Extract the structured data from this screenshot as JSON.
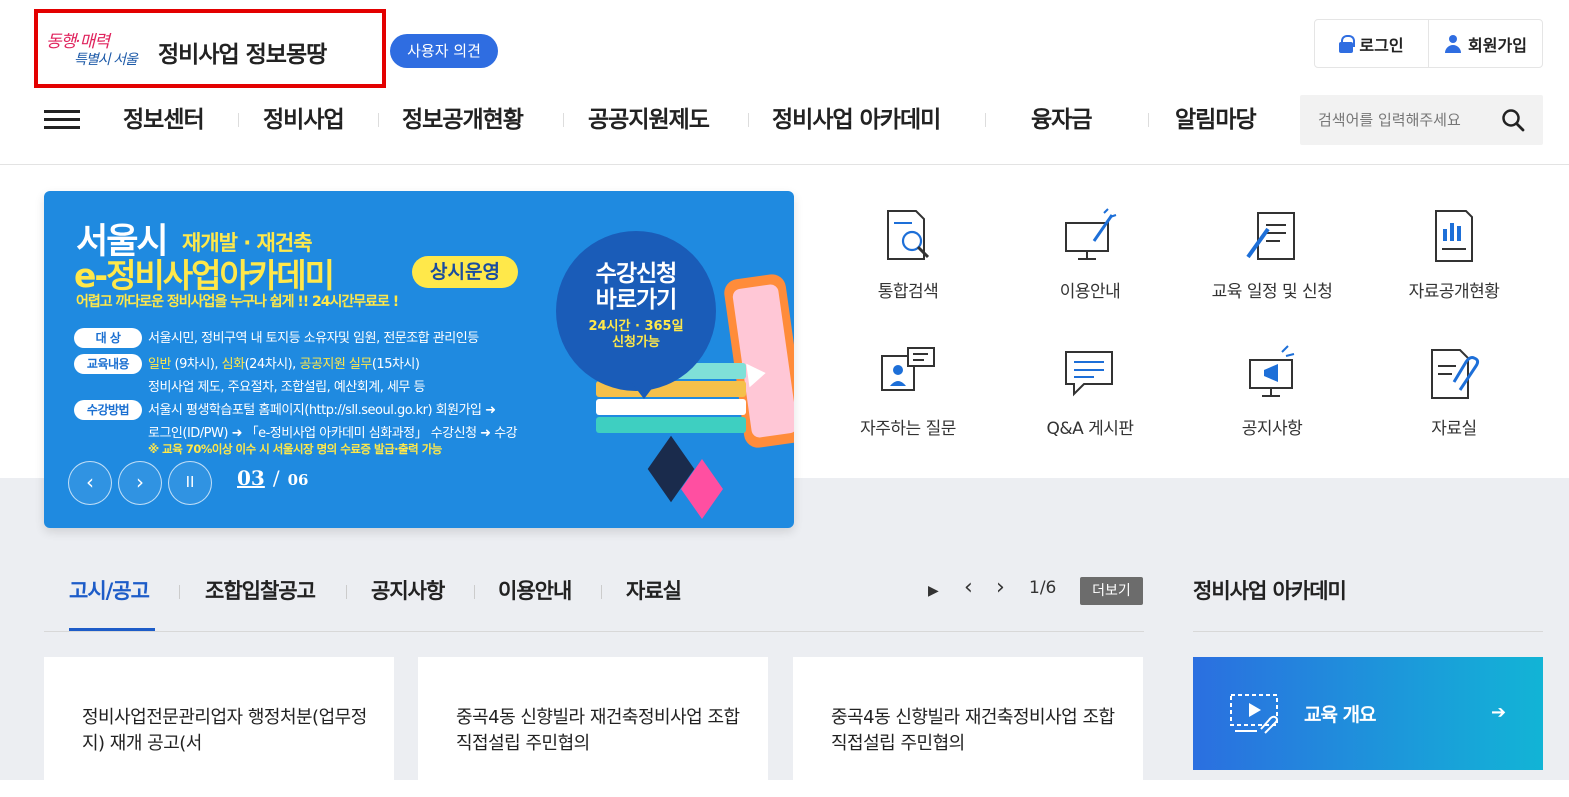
{
  "header": {
    "logo_line1": "동행·매력",
    "logo_line2": "특별시 서울",
    "site_title": "정비사업 정보몽땅",
    "opinion_button": "사용자 의견",
    "login": "로그인",
    "signup": "회원가입"
  },
  "nav": {
    "items": [
      "정보센터",
      "정비사업",
      "정보공개현황",
      "공공지원제도",
      "정비사업 아카데미",
      "융자금",
      "알림마당"
    ]
  },
  "search": {
    "placeholder": "검색어를 입력해주세요"
  },
  "banner": {
    "title1": "서울시",
    "title1_sub": "재개발 · 재건축",
    "title2": "e-정비사업아카데미",
    "badge": "상시운영",
    "subtitle": "어렵고 까다로운 정비사업을  누구나 쉽게 !!  24시간무료로 !",
    "rows": [
      {
        "chip": "대    상",
        "text": "서울시민, 정비구역 내 토지등 소유자및 임원, 전문조합 관리인등",
        "cont": ""
      },
      {
        "chip": "교육내용",
        "hl1": "일반",
        "text1": " (9차시), ",
        "hl2": "심화",
        "text2": "(24차시), ",
        "hl3": "공공지원 실무",
        "text3": "(15차시)",
        "cont": "정비사업 제도, 주요절차, 조합설립, 예산회계, 세무 등"
      },
      {
        "chip": "수강방법",
        "text": "서울시 평생학습포털 홈페이지(http://sll.seoul.go.kr) 회원가입 ➜",
        "cont": "로그인(ID/PW) ➜ 「e-정비사업 아카데미 심화과정」 수강신청 ➜ 수강"
      }
    ],
    "note": "※ 교육 70%이상 이수 시 서울시장 명의 수료증 발급·출력 가능",
    "circle_title": "수강신청\n바로가기",
    "circle_sub": "24시간 · 365일\n신청가능",
    "page_current": "03",
    "page_sep": "/",
    "page_total": "06",
    "prev": "‹",
    "next": "›",
    "pause": "II"
  },
  "quick_links": [
    "통합검색",
    "이용안내",
    "교육 일정 및 신청",
    "자료공개현황",
    "자주하는 질문",
    "Q&A 게시판",
    "공지사항",
    "자료실"
  ],
  "board": {
    "tabs": [
      "고시/공고",
      "조합입찰공고",
      "공지사항",
      "이용안내",
      "자료실"
    ],
    "active_tab": "고시/공고",
    "play": "▶",
    "prev": "‹",
    "next": "›",
    "pager": "1/6",
    "more": "더보기",
    "cards": [
      "정비사업전문관리업자 행정처분(업무정지) 재개 공고(서",
      "중곡4동 신향빌라 재건축정비사업 조합직접설립 주민협의",
      "중곡4동 신향빌라 재건축정비사업 조합직접설립 주민협의"
    ]
  },
  "academy": {
    "title": "정비사업 아카데미",
    "card_label": "교육 개요",
    "arrow": "➔"
  },
  "colors": {
    "primary_blue": "#2f6de1",
    "banner_blue": "#1f8ae0",
    "highlight_yellow": "#ffe84a",
    "logo_red_border": "#e30000",
    "academy_gradient_start": "#2b6fe0",
    "academy_gradient_end": "#12b4d6"
  },
  "icons": [
    "lock-icon",
    "user-icon",
    "menu-icon",
    "search-icon",
    "integrated-search-icon",
    "guide-icon",
    "edu-schedule-icon",
    "data-status-icon",
    "faq-icon",
    "qna-icon",
    "notice-icon",
    "archive-icon",
    "video-icon"
  ]
}
